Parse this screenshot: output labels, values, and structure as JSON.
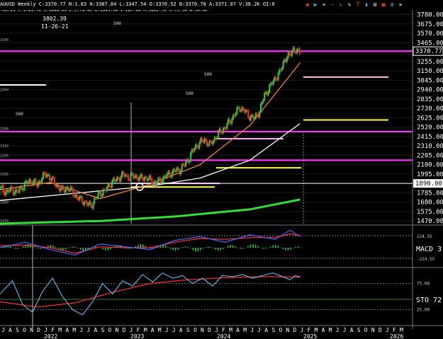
{
  "header": {
    "text": "AUUSD Weekly  C:3370.77  N:1.83  H:3387.84  L:3347.54  O:3370.52  B:3370.78  A:3371.07  V:38.2K  OI:0",
    "subline": "-26-21 C:1781.76 H:1848.69 L:1778.42 O:1845.34 V:287.6K H:3802.39 R:70.54 N:54.66",
    "annot_value": "3802.39",
    "annot_date": "11-26-21"
  },
  "toolbar": {
    "icons": [
      "back-icon",
      "forward-icon",
      "zoom-in-icon",
      "zoom-out-icon",
      "cursor-icon",
      "draw-icon",
      "text-icon",
      "bars-icon",
      "settings-icon",
      "layout-icon",
      "grid-icon",
      "close-icon"
    ],
    "glyphs": [
      "◀",
      "▶",
      "+",
      "−",
      "↖",
      "✎",
      "T",
      "▮",
      "⚙",
      "▦",
      "⊞",
      "✕"
    ]
  },
  "colors": {
    "bg": "#000000",
    "up": "#2ecc40",
    "down": "#ff2a2a",
    "magenta": "#ff33ff",
    "yellow": "#ffff33",
    "ma_fast": "#ff8c33",
    "ma_mid": "#ffffff",
    "ma_slow": "#33dd33",
    "macd_line": "#4d6bff",
    "signal_line": "#ff3333",
    "sto": "#66ccff",
    "sto_sig": "#ff3333"
  },
  "chart_data": {
    "type": "candlestick",
    "price_axis": {
      "ticks": [
        3780.0,
        3675.0,
        3570.0,
        3465.0,
        3360.0,
        3255.0,
        3150.0,
        3045.0,
        2940.0,
        2835.0,
        2730.0,
        2625.0,
        2520.0,
        2415.0,
        2310.0,
        2205.0,
        2100.0,
        1995.0,
        1890.0,
        1785.0,
        1680.0,
        1575.0,
        1470.0
      ],
      "range": [
        1440,
        3800
      ],
      "current": "3370.77",
      "marker": "1890.00"
    },
    "left_tags": [
      "3500",
      "2940",
      "2500",
      "2310",
      "2205",
      "1995",
      "1785",
      "1680",
      "1470"
    ],
    "inline_labels": [
      "500",
      "500",
      "500",
      "500"
    ],
    "horizontal_lines": {
      "magenta": [
        3370,
        2470,
        2150
      ],
      "yellow": [
        2600,
        2065,
        1850
      ],
      "white": [
        3080,
        2390,
        1890
      ]
    },
    "time_axis": {
      "months": [
        "J",
        "A",
        "S",
        "O",
        "N",
        "D",
        "J",
        "F",
        "M",
        "A",
        "M",
        "J",
        "J",
        "A",
        "S",
        "O",
        "N",
        "D",
        "J",
        "F",
        "M",
        "A",
        "M",
        "J",
        "J",
        "A",
        "S",
        "O",
        "N",
        "D",
        "J",
        "F",
        "M",
        "A",
        "M",
        "J",
        "J",
        "A",
        "S",
        "O",
        "N",
        "D",
        "J",
        "F",
        "M",
        "A",
        "M",
        "J",
        "J",
        "A",
        "S",
        "O",
        "N",
        "D",
        "J",
        "F",
        "M"
      ],
      "years": [
        "2022",
        "2023",
        "2024",
        "2025",
        "2026"
      ]
    },
    "price_path": [
      [
        0,
        1830
      ],
      [
        4,
        1795
      ],
      [
        9,
        1820
      ],
      [
        13,
        1790
      ],
      [
        17,
        1850
      ],
      [
        21,
        1900
      ],
      [
        25,
        1920
      ],
      [
        29,
        1870
      ],
      [
        33,
        1960
      ],
      [
        37,
        1990
      ],
      [
        41,
        1930
      ],
      [
        45,
        1860
      ],
      [
        49,
        1810
      ],
      [
        53,
        1840
      ],
      [
        57,
        1800
      ],
      [
        61,
        1730
      ],
      [
        65,
        1700
      ],
      [
        69,
        1660
      ],
      [
        72,
        1640
      ],
      [
        75,
        1700
      ],
      [
        79,
        1780
      ],
      [
        83,
        1800
      ],
      [
        87,
        1880
      ],
      [
        91,
        1920
      ],
      [
        95,
        1960
      ],
      [
        99,
        1990
      ],
      [
        103,
        1950
      ],
      [
        107,
        1980
      ],
      [
        111,
        1940
      ],
      [
        115,
        1960
      ],
      [
        119,
        1930
      ],
      [
        123,
        1900
      ],
      [
        127,
        1920
      ],
      [
        131,
        1960
      ],
      [
        135,
        2000
      ],
      [
        139,
        2030
      ],
      [
        143,
        2040
      ],
      [
        147,
        2100
      ],
      [
        151,
        2180
      ],
      [
        155,
        2290
      ],
      [
        159,
        2340
      ],
      [
        163,
        2380
      ],
      [
        167,
        2320
      ],
      [
        171,
        2390
      ],
      [
        175,
        2460
      ],
      [
        179,
        2510
      ],
      [
        183,
        2580
      ],
      [
        187,
        2660
      ],
      [
        191,
        2740
      ],
      [
        195,
        2700
      ],
      [
        199,
        2640
      ],
      [
        203,
        2620
      ],
      [
        207,
        2700
      ],
      [
        211,
        2880
      ],
      [
        215,
        2960
      ],
      [
        219,
        3060
      ],
      [
        223,
        3120
      ],
      [
        227,
        3280
      ],
      [
        231,
        3320
      ],
      [
        234,
        3400
      ],
      [
        237,
        3350
      ],
      [
        240,
        3380
      ]
    ],
    "ma_fast": [
      [
        0,
        1820
      ],
      [
        40,
        1900
      ],
      [
        80,
        1720
      ],
      [
        120,
        1880
      ],
      [
        160,
        2100
      ],
      [
        200,
        2540
      ],
      [
        240,
        3240
      ]
    ],
    "ma_mid": [
      [
        0,
        1700
      ],
      [
        60,
        1780
      ],
      [
        120,
        1860
      ],
      [
        160,
        1950
      ],
      [
        200,
        2150
      ],
      [
        240,
        2560
      ]
    ],
    "ma_slow": [
      [
        0,
        1440
      ],
      [
        80,
        1470
      ],
      [
        140,
        1520
      ],
      [
        200,
        1600
      ],
      [
        240,
        1710
      ]
    ],
    "macd": {
      "label": "MACD 3",
      "ticks": [
        "224.55",
        "-224.55"
      ],
      "line": [
        [
          0,
          0
        ],
        [
          20,
          60
        ],
        [
          40,
          -20
        ],
        [
          60,
          -80
        ],
        [
          80,
          40
        ],
        [
          100,
          10
        ],
        [
          120,
          -20
        ],
        [
          140,
          80
        ],
        [
          160,
          120
        ],
        [
          180,
          60
        ],
        [
          200,
          140
        ],
        [
          220,
          90
        ],
        [
          232,
          190
        ],
        [
          240,
          120
        ]
      ],
      "signal": [
        [
          0,
          20
        ],
        [
          20,
          30
        ],
        [
          40,
          0
        ],
        [
          60,
          -60
        ],
        [
          80,
          10
        ],
        [
          100,
          0
        ],
        [
          120,
          0
        ],
        [
          140,
          60
        ],
        [
          160,
          100
        ],
        [
          180,
          90
        ],
        [
          200,
          110
        ],
        [
          220,
          110
        ],
        [
          232,
          150
        ],
        [
          240,
          130
        ]
      ]
    },
    "sto": {
      "label": "STO  72",
      "ticks": [
        "75.00",
        "25.00"
      ],
      "line": [
        [
          0,
          55
        ],
        [
          10,
          80
        ],
        [
          18,
          35
        ],
        [
          26,
          20
        ],
        [
          34,
          60
        ],
        [
          42,
          85
        ],
        [
          50,
          50
        ],
        [
          58,
          25
        ],
        [
          66,
          15
        ],
        [
          74,
          40
        ],
        [
          82,
          75
        ],
        [
          90,
          55
        ],
        [
          98,
          80
        ],
        [
          106,
          70
        ],
        [
          114,
          92
        ],
        [
          122,
          78
        ],
        [
          130,
          95
        ],
        [
          138,
          85
        ],
        [
          146,
          90
        ],
        [
          154,
          75
        ],
        [
          162,
          85
        ],
        [
          170,
          70
        ],
        [
          178,
          90
        ],
        [
          186,
          88
        ],
        [
          194,
          92
        ],
        [
          202,
          85
        ],
        [
          210,
          90
        ],
        [
          218,
          95
        ],
        [
          226,
          88
        ],
        [
          232,
          82
        ],
        [
          236,
          90
        ],
        [
          240,
          88
        ]
      ],
      "signal": [
        [
          0,
          40
        ],
        [
          30,
          30
        ],
        [
          60,
          38
        ],
        [
          90,
          58
        ],
        [
          120,
          75
        ],
        [
          150,
          82
        ],
        [
          180,
          86
        ],
        [
          210,
          88
        ],
        [
          240,
          87
        ]
      ]
    }
  }
}
